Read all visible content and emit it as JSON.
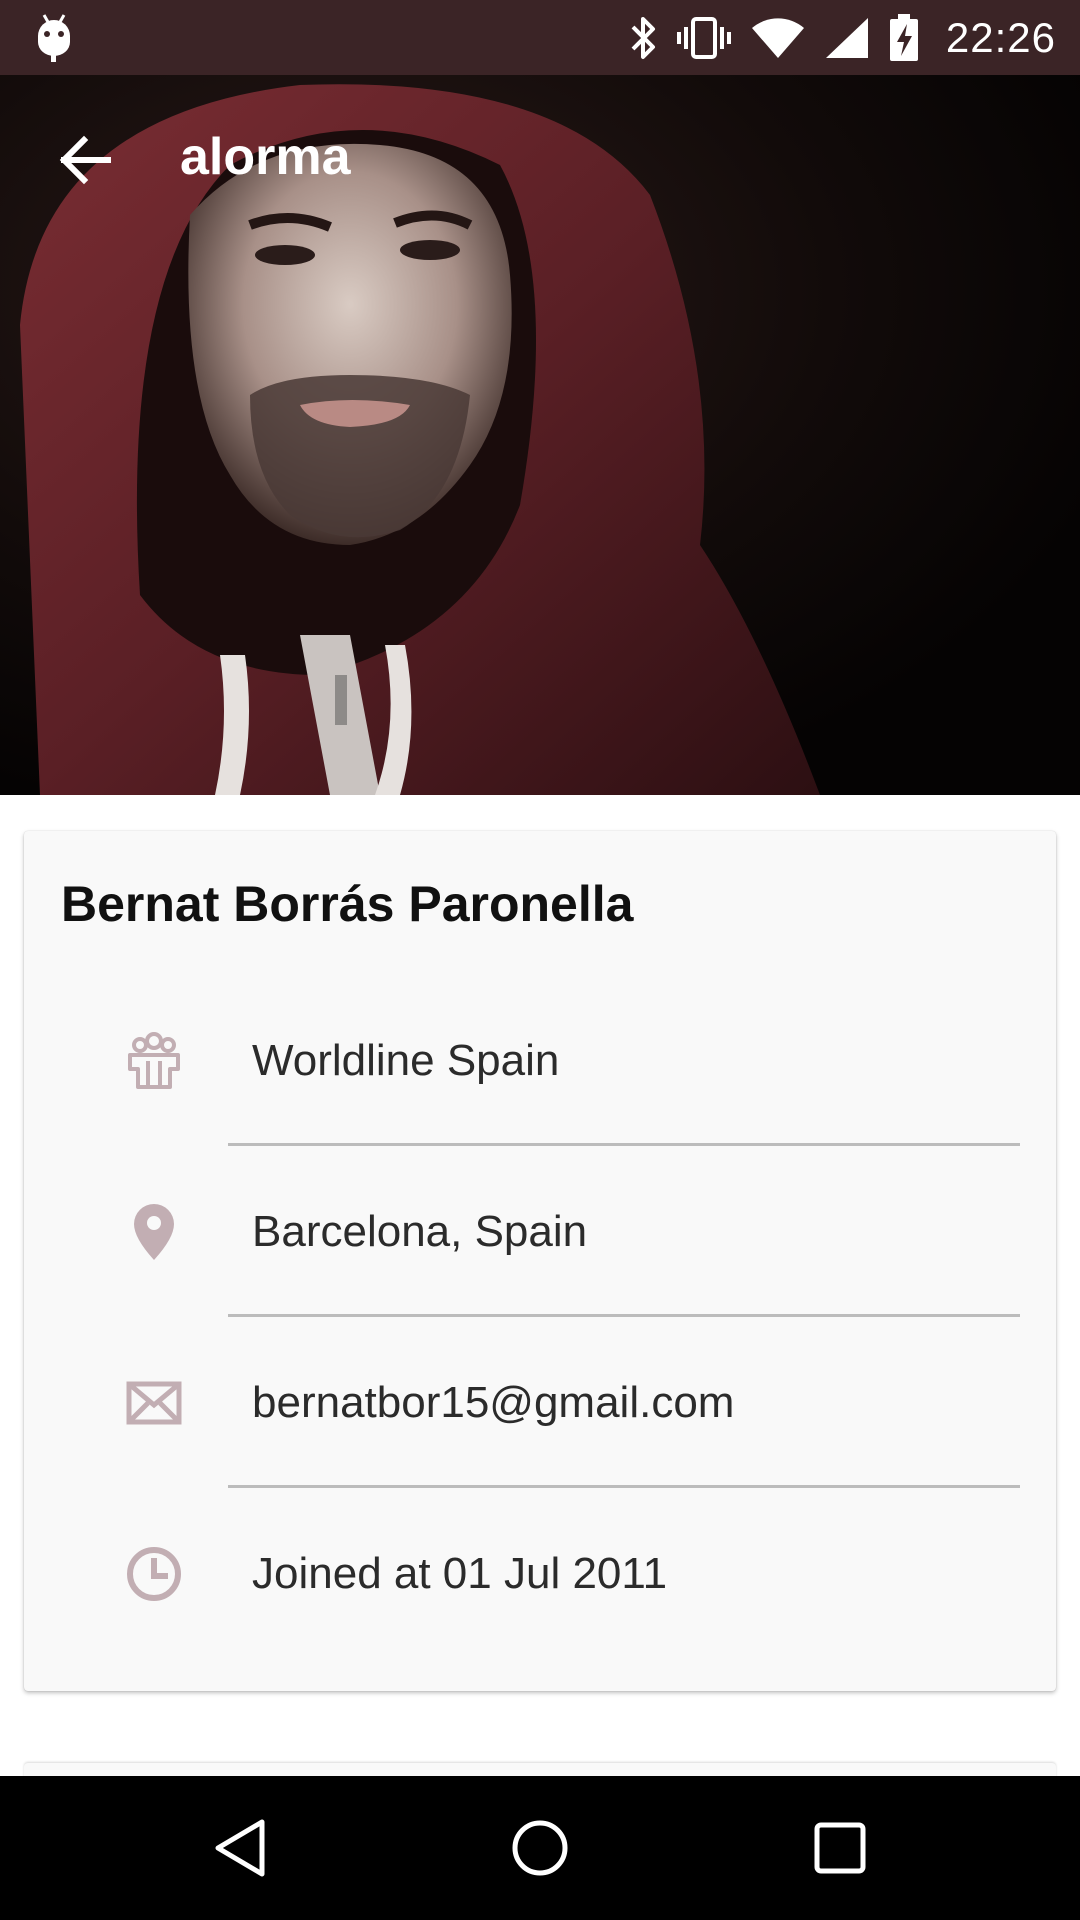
{
  "status_bar": {
    "time": "22:26",
    "icons": [
      "android-debug-icon",
      "bluetooth-icon",
      "vibrate-icon",
      "wifi-icon",
      "cell-signal-icon",
      "battery-charging-icon"
    ]
  },
  "toolbar": {
    "title": "alorma",
    "back_icon": "arrow-back-icon"
  },
  "header": {
    "image": "profile-cover-photo"
  },
  "profile": {
    "name": "Bernat Borrás Paronella",
    "rows": [
      {
        "icon": "organization-icon",
        "text": "Worldline Spain"
      },
      {
        "icon": "location-pin-icon",
        "text": "Barcelona, Spain"
      },
      {
        "icon": "mail-icon",
        "text": "bernatbor15@gmail.com"
      },
      {
        "icon": "clock-icon",
        "text": "Joined at 01 Jul 2011"
      }
    ]
  },
  "nav_bar": {
    "buttons": [
      "back-triangle-icon",
      "home-circle-icon",
      "recents-square-icon"
    ]
  },
  "colors": {
    "status_bar_bg": "#3b2426",
    "icon_tint": "#c2aeb3",
    "card_bg": "#f9f9f9",
    "divider": "#bcbcbc",
    "nav_bar_bg": "#000000"
  }
}
